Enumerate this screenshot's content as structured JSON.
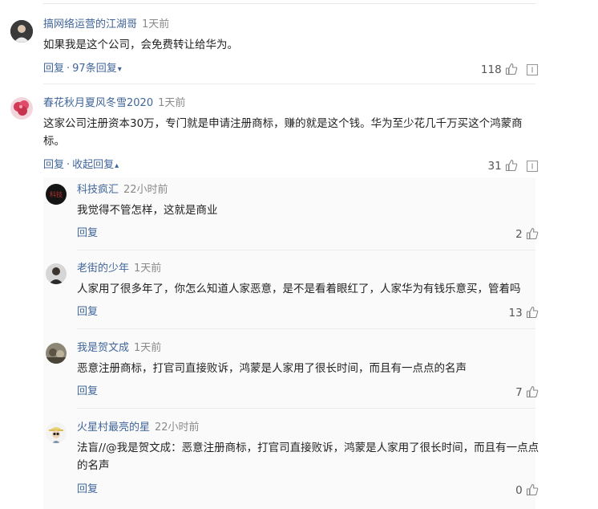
{
  "comments": [
    {
      "name": "搞网络运营的江湖哥",
      "time": "1天前",
      "text": "如果我是这个公司，会免费转让给华为。",
      "reply_label": "回复",
      "sub_label": "97条回复",
      "likes": "118"
    },
    {
      "name": "春花秋月夏风冬雪2020",
      "time": "1天前",
      "text": "这家公司注册资本30万，专门就是申请注册商标，赚的就是这个钱。华为至少花几千万买这个鸿蒙商标。",
      "reply_label": "回复",
      "sub_label": "收起回复",
      "likes": "31"
    }
  ],
  "replies": [
    {
      "name": "科技疯汇",
      "time": "22小时前",
      "text": "我觉得不管怎样，这就是商业",
      "reply_label": "回复",
      "likes": "2"
    },
    {
      "name": "老街的少年",
      "time": "1天前",
      "text": "人家用了很多年了，你怎么知道人家恶意，是不是看着眼红了，人家华为有钱乐意买，管着吗",
      "reply_label": "回复",
      "likes": "13"
    },
    {
      "name": "我是贺文成",
      "time": "1天前",
      "text": "恶意注册商标，打官司直接败诉，鸿蒙是人家用了很长时间，而且有一点点的名声",
      "reply_label": "回复",
      "likes": "7"
    },
    {
      "name": "火星村最亮的星",
      "time": "22小时前",
      "text": "法盲//@我是贺文成：恶意注册商标，打官司直接败诉，鸿蒙是人家用了很长时间，而且有一点点的名声",
      "reply_label": "回复",
      "likes": "0"
    }
  ],
  "colors": {
    "link": "#406599",
    "time": "#8a8a8a",
    "text": "#222222"
  },
  "icons": {
    "like": "thumbs-up-icon",
    "more": "report-icon"
  }
}
